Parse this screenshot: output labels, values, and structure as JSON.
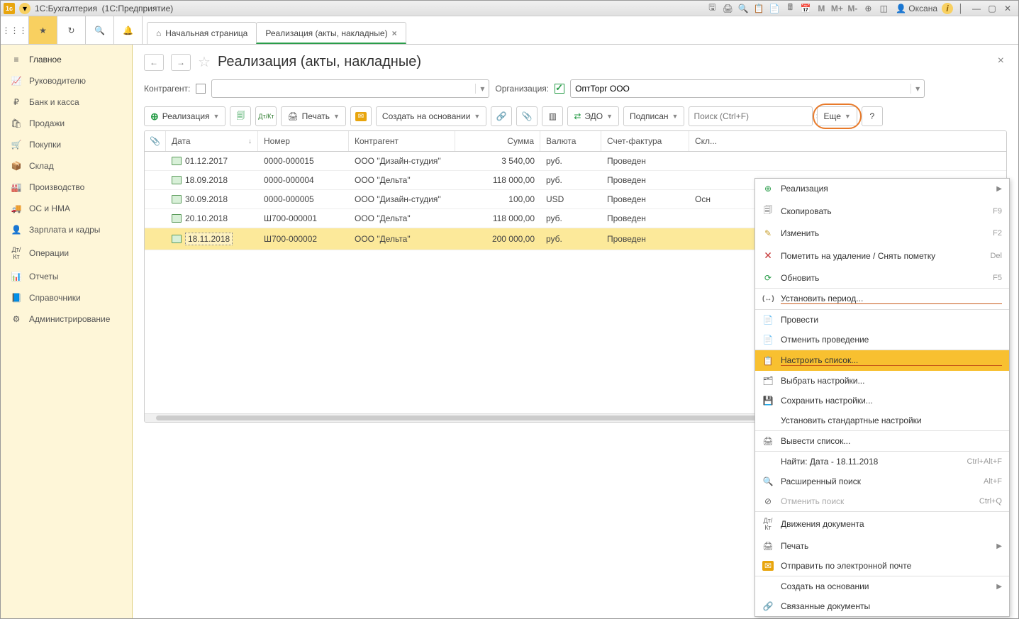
{
  "titlebar": {
    "app": "1С:Бухгалтерия",
    "mode": "(1С:Предприятие)",
    "user": "Оксана",
    "mem": {
      "m": "М",
      "mplus": "М+",
      "mminus": "М-"
    }
  },
  "tabs": {
    "home": "Начальная страница",
    "active": "Реализация (акты, накладные)"
  },
  "sidebar": {
    "items": [
      {
        "label": "Главное",
        "icon": "≡"
      },
      {
        "label": "Руководителю",
        "icon": "📈"
      },
      {
        "label": "Банк и касса",
        "icon": "₽"
      },
      {
        "label": "Продажи",
        "icon": "🛍"
      },
      {
        "label": "Покупки",
        "icon": "🛒"
      },
      {
        "label": "Склад",
        "icon": "📦"
      },
      {
        "label": "Производство",
        "icon": "🏭"
      },
      {
        "label": "ОС и НМА",
        "icon": "🚚"
      },
      {
        "label": "Зарплата и кадры",
        "icon": "👤"
      },
      {
        "label": "Операции",
        "icon": "Дт/Кт"
      },
      {
        "label": "Отчеты",
        "icon": "📊"
      },
      {
        "label": "Справочники",
        "icon": "📘"
      },
      {
        "label": "Администрирование",
        "icon": "⚙"
      }
    ]
  },
  "page": {
    "title": "Реализация (акты, накладные)"
  },
  "filters": {
    "contr_label": "Контрагент:",
    "contr_value": "",
    "org_label": "Организация:",
    "org_value": "ОптТорг ООО"
  },
  "toolbar": {
    "realize": "Реализация",
    "print": "Печать",
    "createbase": "Создать на основании",
    "edo": "ЭДО",
    "signed": "Подписан",
    "search_placeholder": "Поиск (Ctrl+F)",
    "more": "Еще",
    "help": "?",
    "movements_short": "Дт/Кт"
  },
  "columns": {
    "date": "Дата",
    "num": "Номер",
    "contr": "Контрагент",
    "sum": "Сумма",
    "cur": "Валюта",
    "inv": "Счет-фактура",
    "stor": "Скл..."
  },
  "rows": [
    {
      "date": "01.12.2017",
      "num": "0000-000015",
      "contr": "ООО \"Дизайн-студия\"",
      "sum": "3 540,00",
      "cur": "руб.",
      "inv": "Проведен",
      "stor": ""
    },
    {
      "date": "18.09.2018",
      "num": "0000-000004",
      "contr": "ООО \"Дельта\"",
      "sum": "118 000,00",
      "cur": "руб.",
      "inv": "Проведен",
      "stor": ""
    },
    {
      "date": "30.09.2018",
      "num": "0000-000005",
      "contr": "ООО \"Дизайн-студия\"",
      "sum": "100,00",
      "cur": "USD",
      "inv": "Проведен",
      "stor": "Осн"
    },
    {
      "date": "20.10.2018",
      "num": "Ш700-000001",
      "contr": "ООО \"Дельта\"",
      "sum": "118 000,00",
      "cur": "руб.",
      "inv": "Проведен",
      "stor": ""
    },
    {
      "date": "18.11.2018",
      "num": "Ш700-000002",
      "contr": "ООО \"Дельта\"",
      "sum": "200 000,00",
      "cur": "руб.",
      "inv": "Проведен",
      "stor": ""
    }
  ],
  "menu": {
    "realize": "Реализация",
    "copy": "Скопировать",
    "copy_sc": "F9",
    "edit": "Изменить",
    "edit_sc": "F2",
    "markdel": "Пометить на удаление / Снять пометку",
    "markdel_sc": "Del",
    "refresh": "Обновить",
    "refresh_sc": "F5",
    "setperiod": "Установить период...",
    "post": "Провести",
    "unpost": "Отменить проведение",
    "configlist": "Настроить список...",
    "choosesett": "Выбрать настройки...",
    "savesett": "Сохранить настройки...",
    "stdsett": "Установить стандартные настройки",
    "export": "Вывести список...",
    "find": "Найти: Дата - 18.11.2018",
    "find_sc": "Ctrl+Alt+F",
    "advsearch": "Расширенный поиск",
    "advsearch_sc": "Alt+F",
    "cancelsearch": "Отменить поиск",
    "cancelsearch_sc": "Ctrl+Q",
    "movements": "Движения документа",
    "print": "Печать",
    "email": "Отправить по электронной почте",
    "createbase": "Создать на основании",
    "linked": "Связанные документы"
  }
}
